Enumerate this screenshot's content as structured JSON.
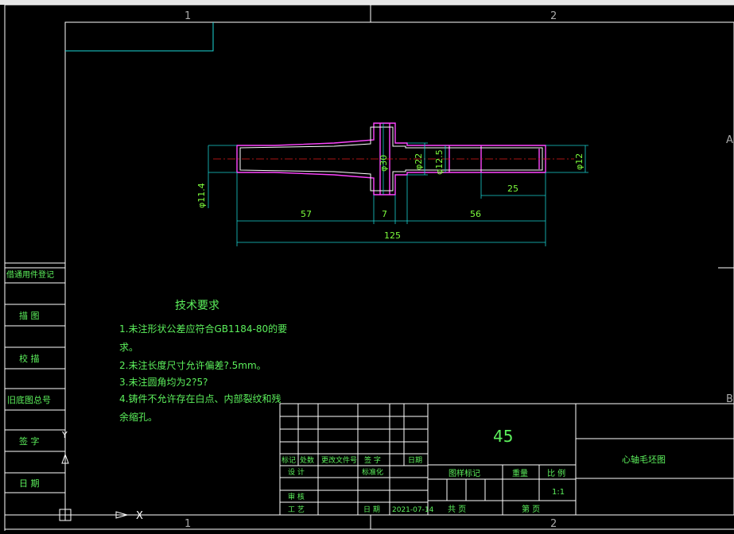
{
  "zones": {
    "col1": "1",
    "col2": "2",
    "rowA": "A",
    "rowB": "B"
  },
  "dimensions": {
    "len_57": "57",
    "len_7": "7",
    "len_56": "56",
    "len_125": "125",
    "len_25": "25",
    "dia_11_4": "φ11.4",
    "dia_30": "φ30",
    "dia_22": "φ22",
    "dia_12_5": "φ12.5",
    "dia_12": "φ12"
  },
  "tech_req": {
    "title": "技术要求",
    "line1": "1.未注形状公差应符合GB1184-80的要",
    "line1b": "求。",
    "line2": "2.未注长度尺寸允许偏差?.5mm。",
    "line3": "3.未注圆角均为2?5?",
    "line4": "4.铸件不允许存在白点、内部裂纹和残",
    "line4b": "余缩孔。"
  },
  "side_block": {
    "item1": "借通用件登记",
    "item2": "描 图",
    "item3": "校 描",
    "item4": "旧底图总号",
    "item5": "签 字",
    "item6": "日 期"
  },
  "title_block": {
    "material": "45",
    "part_name": "心轴毛坯图",
    "mark": "标记",
    "count": "处数",
    "change_doc": "更改文件号",
    "signature": "签 字",
    "date_label": "日期",
    "design": "设 计",
    "standardize": "标准化",
    "review": "审 核",
    "process": "工 艺",
    "date2": "日 期",
    "date_value": "2021-07-14",
    "stage_mark": "图样标记",
    "weight": "重量",
    "scale_label": "比 例",
    "scale_value": "1:1",
    "total_sheets": "共  页",
    "sheet_no": "第  页"
  }
}
